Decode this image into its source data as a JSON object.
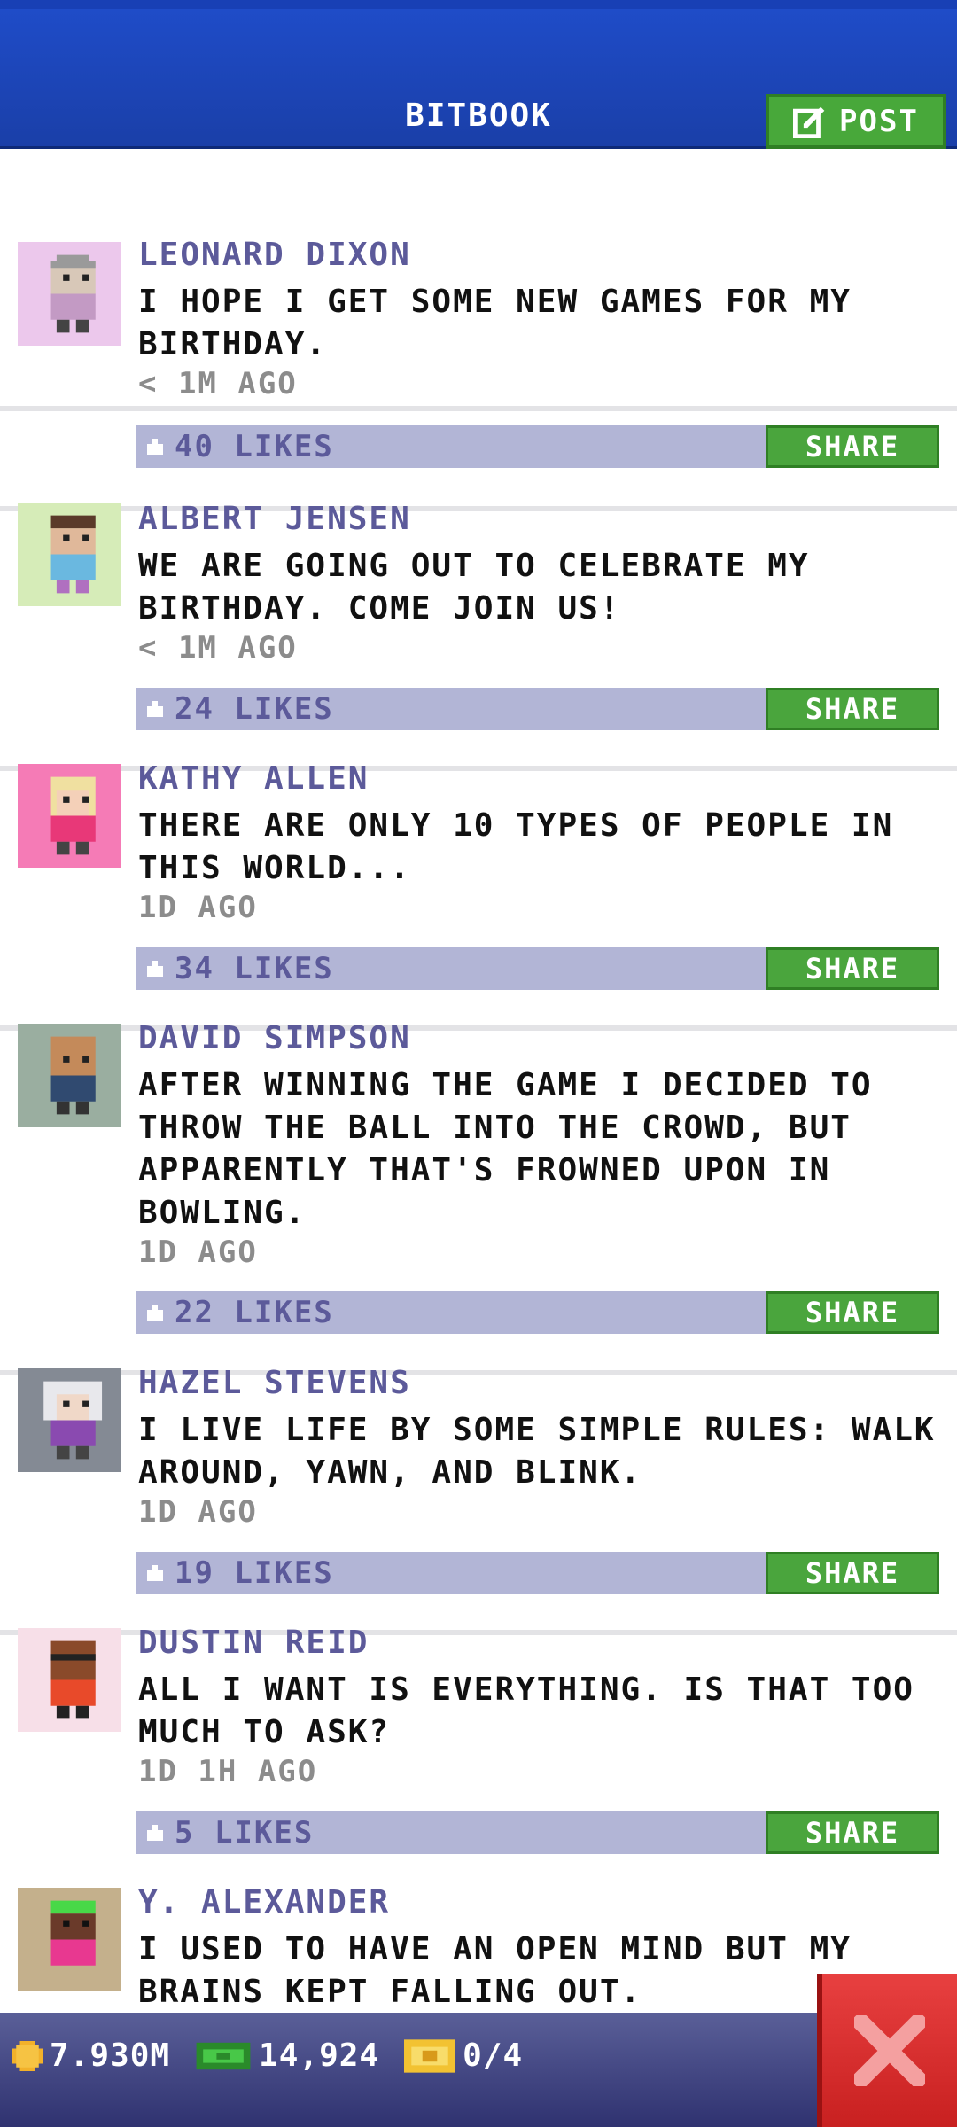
{
  "header": {
    "title": "BITBOOK",
    "post_label": "POST"
  },
  "posts": [
    {
      "author": "LEONARD DIXON",
      "lines": [
        "I HOPE I GET SOME NEW GAMES FOR MY",
        "BIRTHDAY."
      ],
      "time": "< 1M AGO",
      "likes": "40 LIKES",
      "share": "SHARE",
      "avatar_bg": "#ecc8ec"
    },
    {
      "author": "ALBERT JENSEN",
      "lines": [
        "WE ARE GOING OUT TO CELEBRATE MY",
        "BIRTHDAY. COME JOIN US!"
      ],
      "time": "< 1M AGO",
      "likes": "24 LIKES",
      "share": "SHARE",
      "avatar_bg": "#d6ecb8"
    },
    {
      "author": "KATHY ALLEN",
      "lines": [
        "THERE ARE ONLY 10 TYPES OF PEOPLE IN",
        "THIS WORLD..."
      ],
      "time": "1D AGO",
      "likes": "34 LIKES",
      "share": "SHARE",
      "avatar_bg": "#f57bb6"
    },
    {
      "author": "DAVID SIMPSON",
      "lines": [
        "AFTER WINNING THE GAME I DECIDED TO",
        "THROW THE BALL INTO THE CROWD, BUT",
        "APPARENTLY THAT'S FROWNED UPON IN",
        "BOWLING."
      ],
      "time": "1D AGO",
      "likes": "22 LIKES",
      "share": "SHARE",
      "avatar_bg": "#9aaea0"
    },
    {
      "author": "HAZEL STEVENS",
      "lines": [
        "I LIVE LIFE BY SOME SIMPLE RULES: WALK",
        "AROUND, YAWN, AND BLINK."
      ],
      "time": "1D AGO",
      "likes": "19 LIKES",
      "share": "SHARE",
      "avatar_bg": "#848a94"
    },
    {
      "author": "DUSTIN REID",
      "lines": [
        "ALL I WANT IS EVERYTHING. IS THAT TOO",
        "MUCH TO ASK?"
      ],
      "time": "1D 1H AGO",
      "likes": "5 LIKES",
      "share": "SHARE",
      "avatar_bg": "#f7dfe8"
    },
    {
      "author": "Y. ALEXANDER",
      "lines": [
        "I USED TO HAVE AN OPEN MIND BUT MY",
        "BRAINS KEPT FALLING OUT."
      ],
      "time": "",
      "likes": "",
      "share": "",
      "avatar_bg": "#c4b08c"
    }
  ],
  "status": {
    "coins": "7.930M",
    "cash": "14,924",
    "tickets": "0/4"
  },
  "colors": {
    "header": "#1f4cc8",
    "share_green": "#4aa53d",
    "likes_bar": "#b2b5d6",
    "author": "#5c5a9a",
    "close_red": "#d83030"
  },
  "icons": {
    "post": "edit-icon",
    "likes": "thumbs-up-icon",
    "coins": "coin-icon",
    "cash": "cash-icon",
    "tickets": "ticket-icon",
    "close": "close-icon"
  }
}
